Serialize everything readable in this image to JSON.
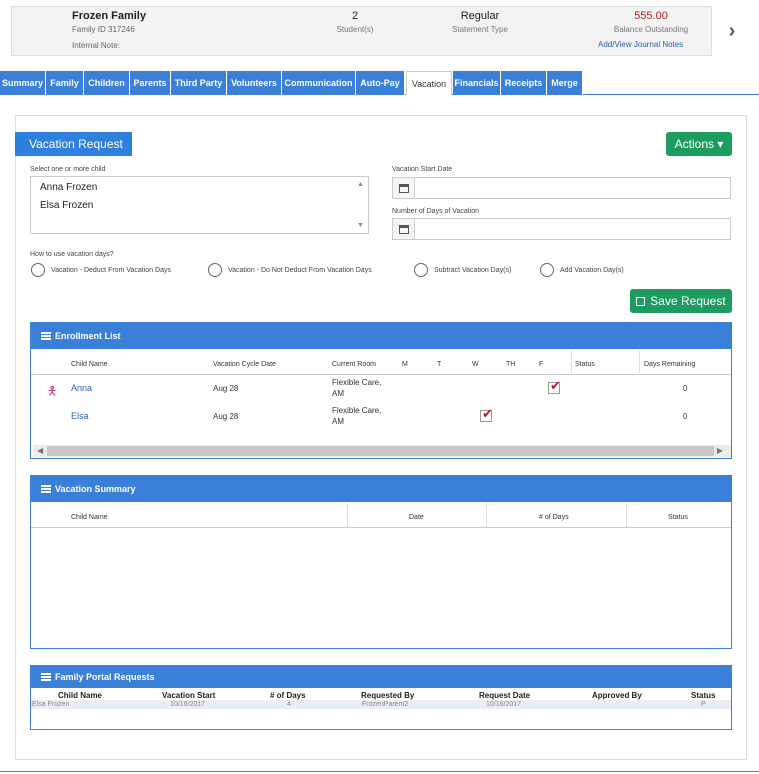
{
  "header": {
    "family_name": "Frozen Family",
    "family_id": "Family ID 317246",
    "internal_note": "Internal Note:",
    "students_value": "2",
    "students_label": "Student(s)",
    "statement_value": "Regular",
    "statement_label": "Statement Type",
    "balance_value": "555.00",
    "balance_label": "Balance Outstanding",
    "journal_link": "Add/View Journal Notes",
    "prev_arrow": "‹",
    "next_arrow": "›"
  },
  "tabs": [
    "Summary",
    "Family",
    "Children",
    "Parents",
    "Third Party",
    "Volunteers",
    "Communication",
    "Auto-Pay",
    "Vacation",
    "Financials",
    "Receipts",
    "Merge"
  ],
  "active_tab": "Vacation",
  "vacation": {
    "title": "Vacation Request",
    "actions_label": "Actions ▾",
    "select_child_label": "Select one or more child",
    "children": [
      "Anna Frozen",
      "Elsa Frozen"
    ],
    "start_date_label": "Vacation Start Date",
    "start_date_value": "",
    "days_label": "Number of Days of Vacation",
    "days_value": "",
    "how_label": "How to use vacation days?",
    "options": [
      "Vacation - Deduct From Vacation Days",
      "Vacation - Do Not Deduct From Vacation Days",
      "Subtract Vacation Day(s)",
      "Add Vacation Day(s)"
    ],
    "save_label": "Save Request"
  },
  "enrollment": {
    "title": "Enrollment List",
    "columns": [
      "Child Name",
      "Vacation Cycle Date",
      "Current Room",
      "M",
      "T",
      "W",
      "TH",
      "F",
      "Status",
      "Days Remaining"
    ],
    "rows": [
      {
        "name": "Anna",
        "cycle": "Aug 28",
        "room1": "Flexible Care,",
        "room2": "AM",
        "checked_day": "F",
        "days": "0"
      },
      {
        "name": "Elsa",
        "cycle": "Aug 28",
        "room1": "Flexible Care,",
        "room2": "AM",
        "checked_day": "W",
        "days": "0"
      }
    ]
  },
  "summary": {
    "title": "Vacation Summary",
    "columns": [
      "Child Name",
      "Date",
      "# of Days",
      "Status"
    ]
  },
  "portal": {
    "title": "Family Portal Requests",
    "columns": [
      "Child Name",
      "Vacation Start",
      "# of Days",
      "Requested By",
      "Request Date",
      "Approved By",
      "Status"
    ],
    "rows": [
      {
        "child": "Elsa Frozen",
        "start": "10/16/2017",
        "days": "4",
        "by": "FrozenParent2",
        "date": "10/16/2017",
        "approved": "",
        "status": "P"
      }
    ]
  }
}
